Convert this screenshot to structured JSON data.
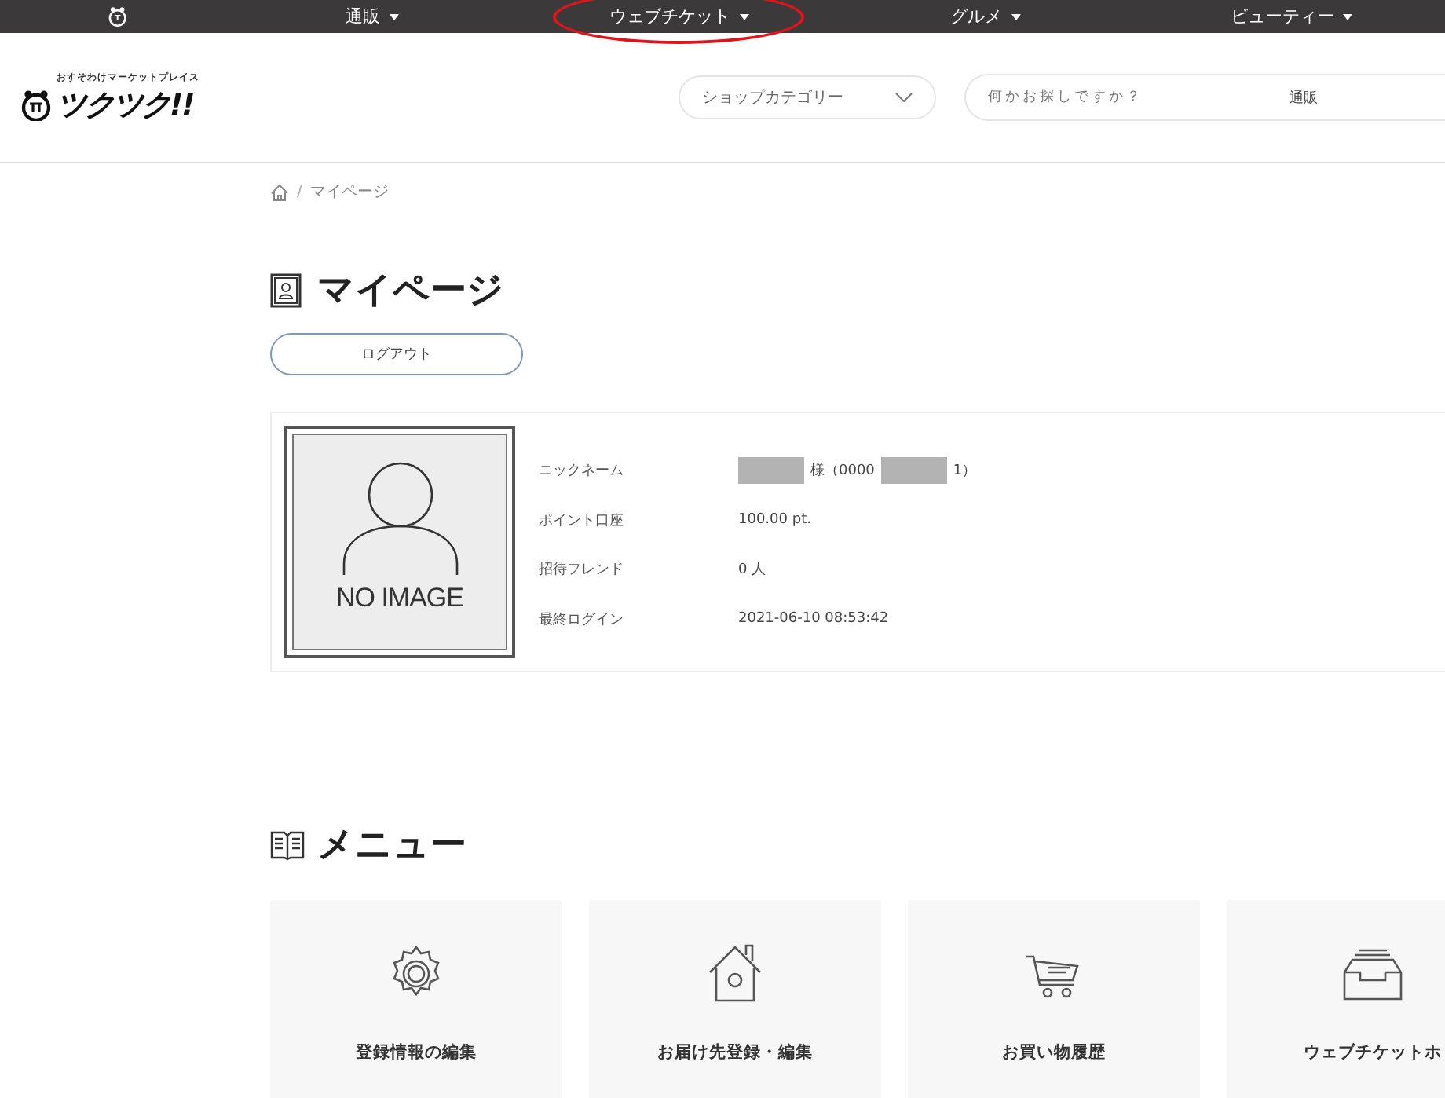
{
  "top_nav": {
    "items": [
      {
        "label": "通販",
        "circled": false
      },
      {
        "label": "ウェブチケット",
        "circled": true
      },
      {
        "label": "グルメ",
        "circled": false
      },
      {
        "label": "ビューティー",
        "circled": false
      }
    ]
  },
  "header": {
    "logo": {
      "tagline": "おすそわけマーケットプレイス",
      "name": "ツクツク!!"
    },
    "category_select": {
      "value": "ショップカテゴリー"
    },
    "search": {
      "placeholder": "何かお探しですか？",
      "scope": "通販"
    }
  },
  "breadcrumb": {
    "separator": "/",
    "items": [
      "マイページ"
    ]
  },
  "page_title": "マイページ",
  "logout_button": "ログアウト",
  "profile": {
    "photo_label": "NO IMAGE",
    "fields": [
      {
        "label": "ニックネーム",
        "value": [
          {
            "kind": "redacted"
          },
          {
            "kind": "text",
            "text": "様（0000"
          },
          {
            "kind": "redacted"
          },
          {
            "kind": "text",
            "text": "1）"
          }
        ]
      },
      {
        "label": "ポイント口座",
        "value": [
          {
            "kind": "text",
            "text": "100.00 pt."
          }
        ]
      },
      {
        "label": "招待フレンド",
        "value": [
          {
            "kind": "text",
            "text": "0 人"
          }
        ]
      },
      {
        "label": "最終ログイン",
        "value": [
          {
            "kind": "text",
            "text": "2021-06-10 08:53:42"
          }
        ]
      }
    ]
  },
  "menu_title": "メニュー",
  "menu_cards": [
    {
      "kind": "gear",
      "label": "登録情報の編集"
    },
    {
      "kind": "house",
      "label": "お届け先登録・編集"
    },
    {
      "kind": "cart",
      "label": "お買い物履歴"
    },
    {
      "kind": "tray",
      "label": "ウェブチケットホ"
    }
  ]
}
